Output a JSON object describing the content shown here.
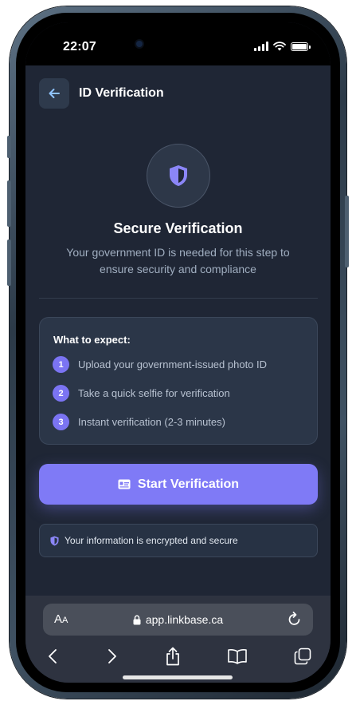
{
  "status": {
    "time": "22:07"
  },
  "header": {
    "title": "ID Verification"
  },
  "hero": {
    "heading": "Secure Verification",
    "description": "Your government ID is needed for this step to ensure security and compliance"
  },
  "expect": {
    "title": "What to expect:",
    "steps": [
      {
        "num": "1",
        "text": "Upload your government-issued photo ID"
      },
      {
        "num": "2",
        "text": "Take a quick selfie for verification"
      },
      {
        "num": "3",
        "text": "Instant verification (2-3 minutes)"
      }
    ]
  },
  "actions": {
    "start_label": "Start Verification"
  },
  "security": {
    "note": "Your information is encrypted and secure"
  },
  "browser": {
    "aa_big": "A",
    "aa_small": "A",
    "url": "app.linkbase.ca"
  },
  "colors": {
    "accent": "#7f7af6",
    "background": "#1f2635",
    "card": "#2b3648"
  },
  "icons": {
    "back": "arrow-left-icon",
    "shield": "shield-icon",
    "id_card": "id-card-icon",
    "lock": "lock-icon",
    "reload": "reload-icon",
    "nav_back": "chevron-left-icon",
    "nav_forward": "chevron-right-icon",
    "share": "share-icon",
    "bookmarks": "book-icon",
    "tabs": "tabs-icon"
  }
}
